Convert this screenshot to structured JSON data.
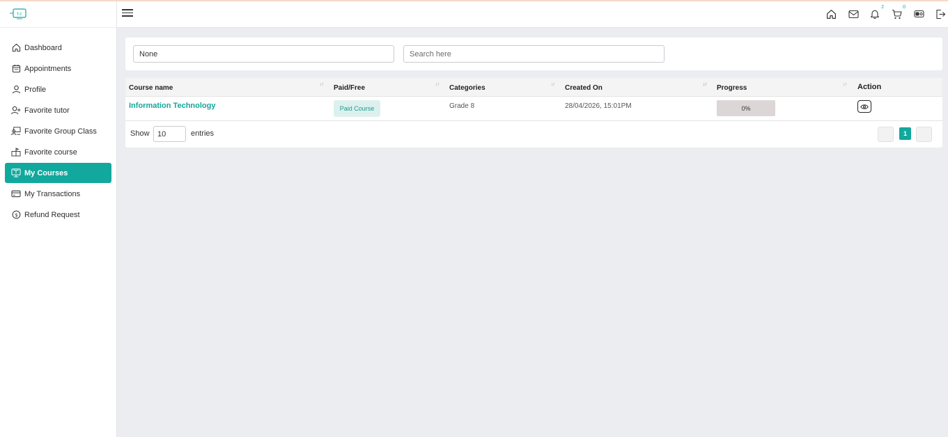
{
  "sidebar": {
    "logo_text": "T-C",
    "items": [
      {
        "label": "Dashboard",
        "icon": "home-icon"
      },
      {
        "label": "Appointments",
        "icon": "calendar-icon"
      },
      {
        "label": "Profile",
        "icon": "user-icon"
      },
      {
        "label": "Favorite tutor",
        "icon": "user-plus-icon"
      },
      {
        "label": "Favorite Group Class",
        "icon": "group-class-icon"
      },
      {
        "label": "Favorite course",
        "icon": "course-icon"
      },
      {
        "label": "My Courses",
        "icon": "monitor-book-icon",
        "active": true
      },
      {
        "label": "My Transactions",
        "icon": "credit-card-icon"
      },
      {
        "label": "Refund Request",
        "icon": "dollar-circle-icon"
      }
    ]
  },
  "header": {
    "notifications_count": "2",
    "cart_count": "0",
    "icons": [
      "home-icon",
      "mail-icon",
      "bell-icon",
      "cart-icon",
      "wallet-icon",
      "logout-icon"
    ]
  },
  "filters": {
    "category_value": "None",
    "search_placeholder": "Search here"
  },
  "table": {
    "columns": [
      "Course name",
      "Paid/Free",
      "Categories",
      "Created On",
      "Progress",
      "Action"
    ],
    "rows": [
      {
        "course_name": "Information Technology",
        "paid_free": "Paid Course",
        "category": "Grade 8",
        "created_on": "28/04/2026, 15:01PM",
        "progress_text": "0%",
        "progress_value": 0
      }
    ]
  },
  "footer": {
    "show_label": "Show",
    "entries_value": "10",
    "entries_label": "entries",
    "current_page": "1"
  },
  "colors": {
    "accent": "#12a89d",
    "badge_bg": "#dcf1ee",
    "progress_bg": "#dcd6d7"
  }
}
